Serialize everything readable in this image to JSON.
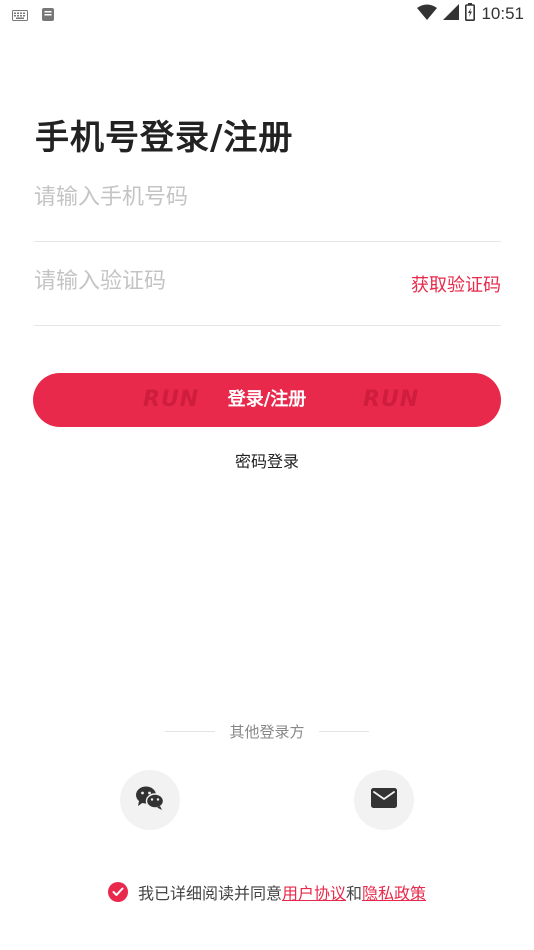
{
  "status_bar": {
    "time": "10:51",
    "icons": [
      "keyboard-icon",
      "notification-icon",
      "wifi-icon",
      "signal-icon",
      "battery-icon"
    ]
  },
  "login": {
    "title": "手机号登录/注册",
    "phone_placeholder": "请输入手机号码",
    "code_placeholder": "请输入验证码",
    "get_code_label": "获取验证码",
    "submit_label": "登录/注册",
    "submit_decor": "RUN",
    "password_login_label": "密码登录"
  },
  "other_login": {
    "title": "其他登录方",
    "options": [
      "wechat-icon",
      "email-icon"
    ]
  },
  "agreement": {
    "prefix": "我已详细阅读并同意",
    "user_agreement": "用户协议",
    "and": "和",
    "privacy_policy": "隐私政策"
  },
  "colors": {
    "accent": "#e8294b",
    "placeholder": "#c4c4c4",
    "divider": "#e6e6e6",
    "social_bg": "#f2f2f2"
  }
}
